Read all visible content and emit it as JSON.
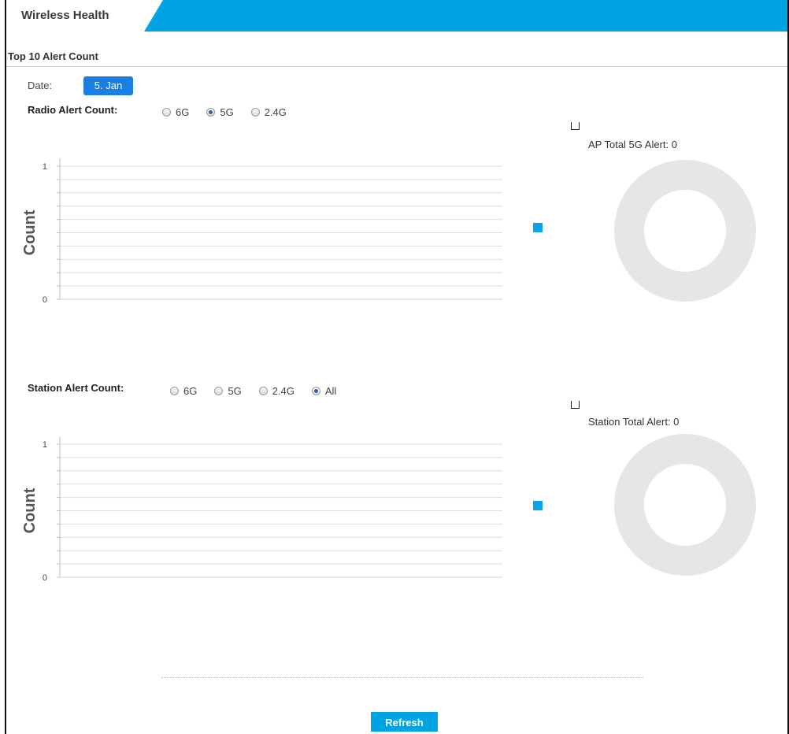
{
  "tab": {
    "label": "Wireless Health"
  },
  "section": {
    "title": "Top 10 Alert Count"
  },
  "date": {
    "label": "Date:",
    "value": "5. Jan"
  },
  "radio_group": {
    "label": "Radio Alert Count:",
    "options": [
      "6G",
      "5G",
      "2.4G"
    ],
    "selected": "5G",
    "y_axis_label": "Count",
    "ticks": [
      "1",
      "0"
    ],
    "summary": "AP Total 5G Alert: 0"
  },
  "station_group": {
    "label": "Station Alert Count:",
    "options": [
      "6G",
      "5G",
      "2.4G",
      "All"
    ],
    "selected": "All",
    "y_axis_label": "Count",
    "ticks": [
      "1",
      "0"
    ],
    "summary": "Station Total Alert: 0"
  },
  "refresh_label": "Refresh",
  "colors": {
    "accent": "#00a4e4",
    "badge": "#1a7fe0",
    "legend": "#0aa3e8",
    "donut_empty": "#e6e6e6"
  },
  "chart_data": [
    {
      "type": "bar",
      "categories": [],
      "values": [],
      "title": "",
      "xlabel": "",
      "ylabel": "Count",
      "ylim": [
        0,
        1
      ],
      "grid": true
    },
    {
      "type": "bar",
      "categories": [],
      "values": [],
      "title": "",
      "xlabel": "",
      "ylabel": "Count",
      "ylim": [
        0,
        1
      ],
      "grid": true
    },
    {
      "type": "pie",
      "categories": [],
      "values": [],
      "title": "AP Total 5G Alert: 0"
    },
    {
      "type": "pie",
      "categories": [],
      "values": [],
      "title": "Station Total Alert: 0"
    }
  ]
}
